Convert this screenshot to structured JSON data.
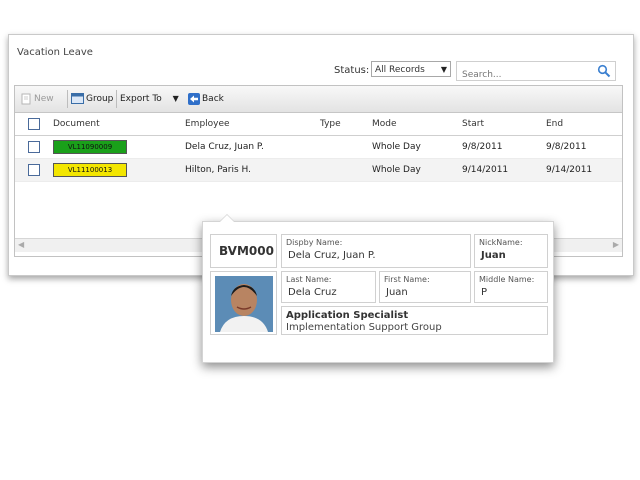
{
  "panel": {
    "title": "Vacation Leave",
    "status_label": "Status:",
    "status_value": "All Records",
    "search_placeholder": "Search..."
  },
  "toolbar": {
    "new_label": "New",
    "group_label": "Group",
    "export_label": "Export To",
    "back_label": "Back"
  },
  "table": {
    "headers": [
      "Document",
      "Employee",
      "Type",
      "Mode",
      "Start",
      "End"
    ],
    "rows": [
      {
        "document": "VL11090009",
        "employee": "Dela Cruz, Juan P.",
        "type": "",
        "mode": "Whole Day",
        "start": "9/8/2011",
        "end": "9/8/2011",
        "badge_color": "#1aa01a"
      },
      {
        "document": "VL11100013",
        "employee": "Hilton, Paris H.",
        "type": "",
        "mode": "Whole Day",
        "start": "9/14/2011",
        "end": "9/14/2011",
        "badge_color": "#f3e600"
      }
    ]
  },
  "popup": {
    "employee_id": "BVM000",
    "display_name_label": "Dispby Name:",
    "display_name": "Dela Cruz, Juan P.",
    "nickname_label": "NickName:",
    "nickname": "Juan",
    "last_name_label": "Last Name:",
    "last_name": "Dela Cruz",
    "first_name_label": "First Name:",
    "first_name": "Juan",
    "middle_name_label": "Middle Name:",
    "middle_name": "P",
    "position": "Application Specialist",
    "department": "Implementation Support Group"
  },
  "colors": {
    "accent_blue": "#3a7fd0",
    "badge_green": "#1aa01a",
    "badge_yellow": "#f3e600"
  },
  "icons": [
    "new-icon",
    "group-icon",
    "dropdown-arrow-icon",
    "back-icon",
    "search-icon",
    "checkbox-icon",
    "profile-photo"
  ]
}
